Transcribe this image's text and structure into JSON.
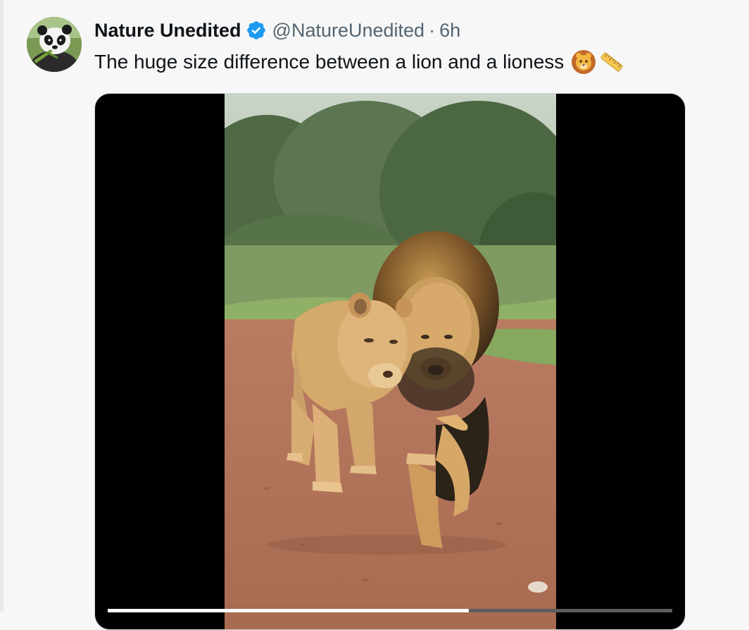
{
  "tweet": {
    "display_name": "Nature Unedited",
    "handle": "@NatureUnedited",
    "separator": "·",
    "time": "6h",
    "text": "The huge size difference between a lion and a lioness",
    "emojis": [
      "lion-face",
      "straight-ruler"
    ],
    "verified": true
  },
  "video": {
    "subject": "lion-and-lioness",
    "progress": 0.64
  },
  "colors": {
    "verified_badge": "#1d9bf0",
    "secondary_text": "#536471",
    "primary_text": "#0f1419"
  }
}
